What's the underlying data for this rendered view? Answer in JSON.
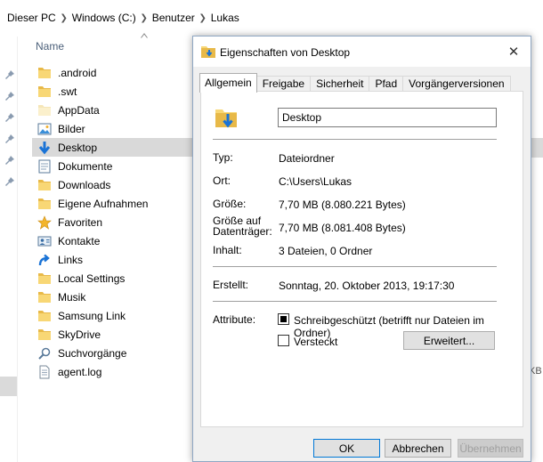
{
  "breadcrumb": [
    "Dieser PC",
    "Windows (C:)",
    "Benutzer",
    "Lukas"
  ],
  "list": {
    "column_name": "Name",
    "items": [
      {
        "label": ".android",
        "icon": "folder-icon"
      },
      {
        "label": ".swt",
        "icon": "folder-icon"
      },
      {
        "label": "AppData",
        "icon": "folder-light-icon"
      },
      {
        "label": "Bilder",
        "icon": "pictures-icon"
      },
      {
        "label": "Desktop",
        "icon": "desktop-folder-icon"
      },
      {
        "label": "Dokumente",
        "icon": "documents-icon"
      },
      {
        "label": "Downloads",
        "icon": "folder-icon"
      },
      {
        "label": "Eigene Aufnahmen",
        "icon": "folder-icon"
      },
      {
        "label": "Favoriten",
        "icon": "star-icon"
      },
      {
        "label": "Kontakte",
        "icon": "contacts-icon"
      },
      {
        "label": "Links",
        "icon": "link-arrow-icon"
      },
      {
        "label": "Local Settings",
        "icon": "folder-icon"
      },
      {
        "label": "Musik",
        "icon": "folder-icon"
      },
      {
        "label": "Samsung Link",
        "icon": "folder-icon"
      },
      {
        "label": "SkyDrive",
        "icon": "folder-icon"
      },
      {
        "label": "Suchvorgänge",
        "icon": "search-icon"
      },
      {
        "label": "agent.log",
        "icon": "file-icon"
      }
    ],
    "selected": "Desktop",
    "partial_size_text": "KB"
  },
  "dialog": {
    "title": "Eigenschaften von Desktop",
    "close_glyph": "✕",
    "tabs": [
      "Allgemein",
      "Freigabe",
      "Sicherheit",
      "Pfad",
      "Vorgängerversionen"
    ],
    "active_tab": "Allgemein",
    "name_value": "Desktop",
    "fields": {
      "typ_label": "Typ:",
      "typ_value": "Dateiordner",
      "ort_label": "Ort:",
      "ort_value": "C:\\Users\\Lukas",
      "groesse_label": "Größe:",
      "groesse_value": "7,70 MB (8.080.221 Bytes)",
      "groesse_dt_label_1": "Größe auf",
      "groesse_dt_label_2": "Datenträger:",
      "groesse_dt_value": "7,70 MB (8.081.408 Bytes)",
      "inhalt_label": "Inhalt:",
      "inhalt_value": "3 Dateien, 0 Ordner",
      "erstellt_label": "Erstellt:",
      "erstellt_value": "Sonntag, 20. Oktober 2013, 19:17:30",
      "attribute_label": "Attribute:"
    },
    "attributes": {
      "readonly_label": "Schreibgeschützt (betrifft nur Dateien im Ordner)",
      "readonly_checked": true,
      "hidden_label": "Versteckt",
      "hidden_checked": false,
      "advanced_button": "Erweitert..."
    },
    "buttons": {
      "ok": "OK",
      "cancel": "Abbrechen",
      "apply": "Übernehmen"
    }
  },
  "colors": {
    "folder_yellow": "#f8d775",
    "folder_dark": "#e0b03c",
    "accent_blue": "#0078d7",
    "selection_gray": "#d9d9d9",
    "column_header": "#4c607a"
  }
}
